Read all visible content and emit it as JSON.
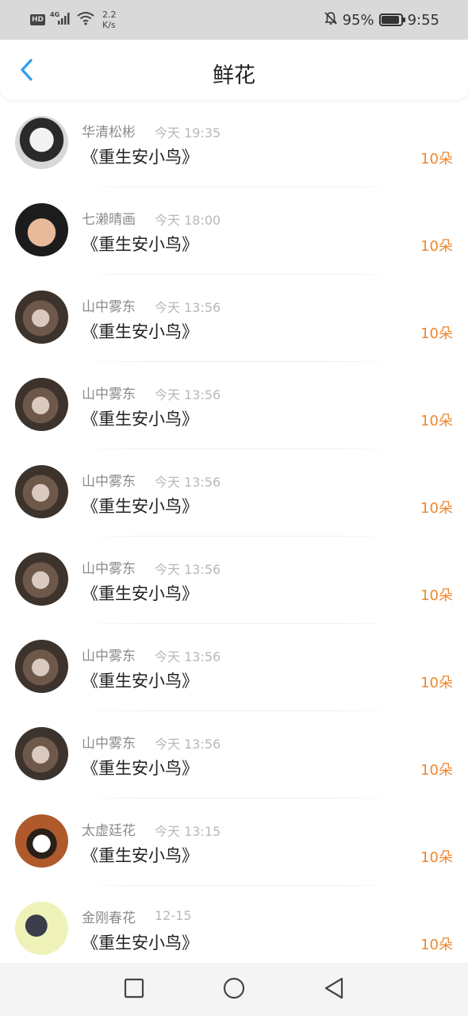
{
  "status_bar": {
    "hd_label": "HD",
    "network_label": "4G",
    "speed_value": "2.2",
    "speed_unit": "K/s",
    "battery_percent": "95%",
    "battery_level": 0.95,
    "time": "9:55"
  },
  "header": {
    "back_icon": "chevron-left-icon",
    "title": "鲜花"
  },
  "colors": {
    "accent": "#2f9df0",
    "flower_count": "#f0862e"
  },
  "list": {
    "items": [
      {
        "name": "华清松彬",
        "time": "今天 19:35",
        "book": "《重生安小鸟》",
        "count": "10朵",
        "avatar": "kind-a"
      },
      {
        "name": "七濑晴画",
        "time": "今天 18:00",
        "book": "《重生安小鸟》",
        "count": "10朵",
        "avatar": "kind-b"
      },
      {
        "name": "山中雾东",
        "time": "今天 13:56",
        "book": "《重生安小鸟》",
        "count": "10朵",
        "avatar": "kind-c"
      },
      {
        "name": "山中雾东",
        "time": "今天 13:56",
        "book": "《重生安小鸟》",
        "count": "10朵",
        "avatar": "kind-c"
      },
      {
        "name": "山中雾东",
        "time": "今天 13:56",
        "book": "《重生安小鸟》",
        "count": "10朵",
        "avatar": "kind-c"
      },
      {
        "name": "山中雾东",
        "time": "今天 13:56",
        "book": "《重生安小鸟》",
        "count": "10朵",
        "avatar": "kind-c"
      },
      {
        "name": "山中雾东",
        "time": "今天 13:56",
        "book": "《重生安小鸟》",
        "count": "10朵",
        "avatar": "kind-c"
      },
      {
        "name": "山中雾东",
        "time": "今天 13:56",
        "book": "《重生安小鸟》",
        "count": "10朵",
        "avatar": "kind-c"
      },
      {
        "name": "太虚廷花",
        "time": "今天 13:15",
        "book": "《重生安小鸟》",
        "count": "10朵",
        "avatar": "kind-d"
      },
      {
        "name": "金刚春花",
        "time": "12-15",
        "book": "《重生安小鸟》",
        "count": "10朵",
        "avatar": "kind-e"
      }
    ]
  },
  "nav_bar": {
    "recents_icon": "square-icon",
    "home_icon": "circle-icon",
    "back_icon": "triangle-back-icon"
  }
}
